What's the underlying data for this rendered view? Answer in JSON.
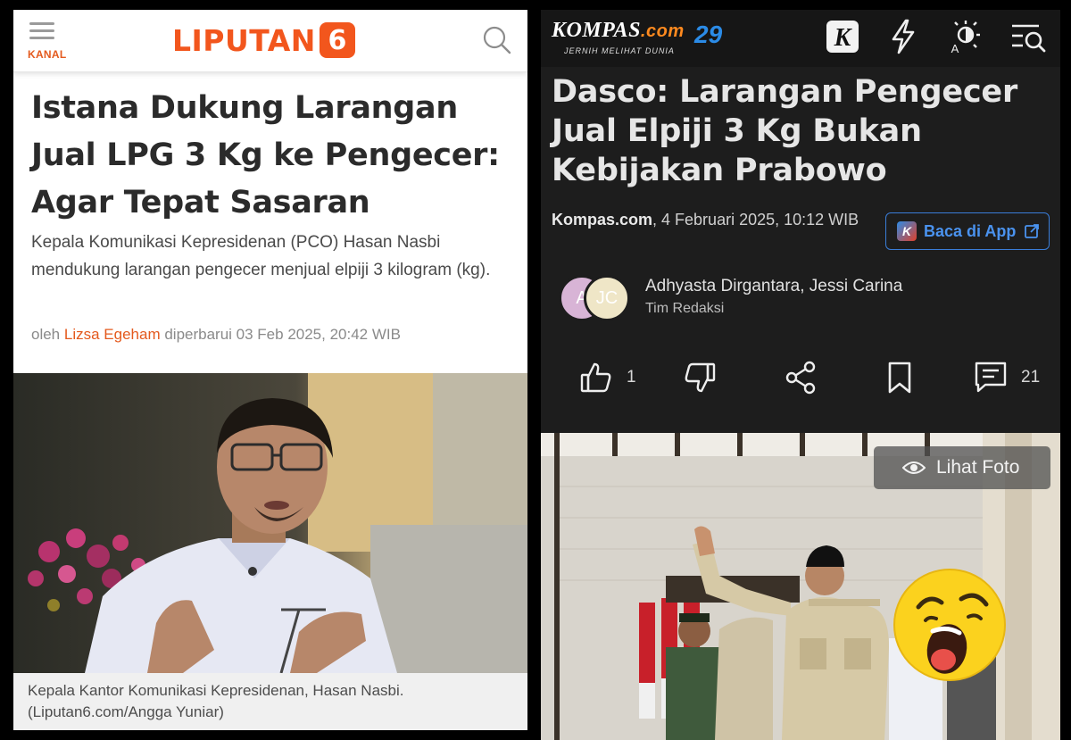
{
  "liputan6": {
    "menu_label": "KANAL",
    "logo_text": "LIPUTAN",
    "logo_number": "6",
    "title": "Istana Dukung Larangan Jual LPG 3 Kg ke Pengecer: Agar Tepat Sasaran",
    "summary": "Kepala Komunikasi Kepresidenan (PCO) Hasan Nasbi mendukung larangan pengecer menjual elpiji 3 kilogram (kg).",
    "byline_prefix": "oleh",
    "author": "Lizsa Egeham",
    "byline_updated": "diperbarui 03 Feb 2025, 20:42 WIB",
    "caption": "Kepala Kantor Komunikasi Kepresidenan, Hasan Nasbi. (Liputan6.com/Angga Yuniar)",
    "accent_color": "#f2561d"
  },
  "kompas": {
    "logo_text": "KOMPAS",
    "logo_domain": ".com",
    "tagline": "JERNIH MELIHAT DUNIA",
    "anniversary": "29",
    "title": "Dasco: Larangan Pengecer Jual Elpiji 3 Kg Bukan Kebijakan Prabowo",
    "source": "Kompas.com",
    "date": ", 4 Februari 2025, 10:12 WIB",
    "app_button": "Baca di App",
    "avatar_initials": [
      "A",
      "JC"
    ],
    "authors": "Adhyasta Dirgantara, Jessi Carina",
    "team": "Tim Redaksi",
    "like_count": "1",
    "comment_count": "21",
    "view_photo": "Lihat Foto",
    "icons": [
      "kompas-k-icon",
      "lightning-icon",
      "brightness-icon",
      "search-menu-icon",
      "thumbs-up-icon",
      "thumbs-down-icon",
      "share-icon",
      "bookmark-icon",
      "comment-icon",
      "eye-icon",
      "shocked-emoji-icon"
    ],
    "accent_color": "#3a7dd8"
  }
}
